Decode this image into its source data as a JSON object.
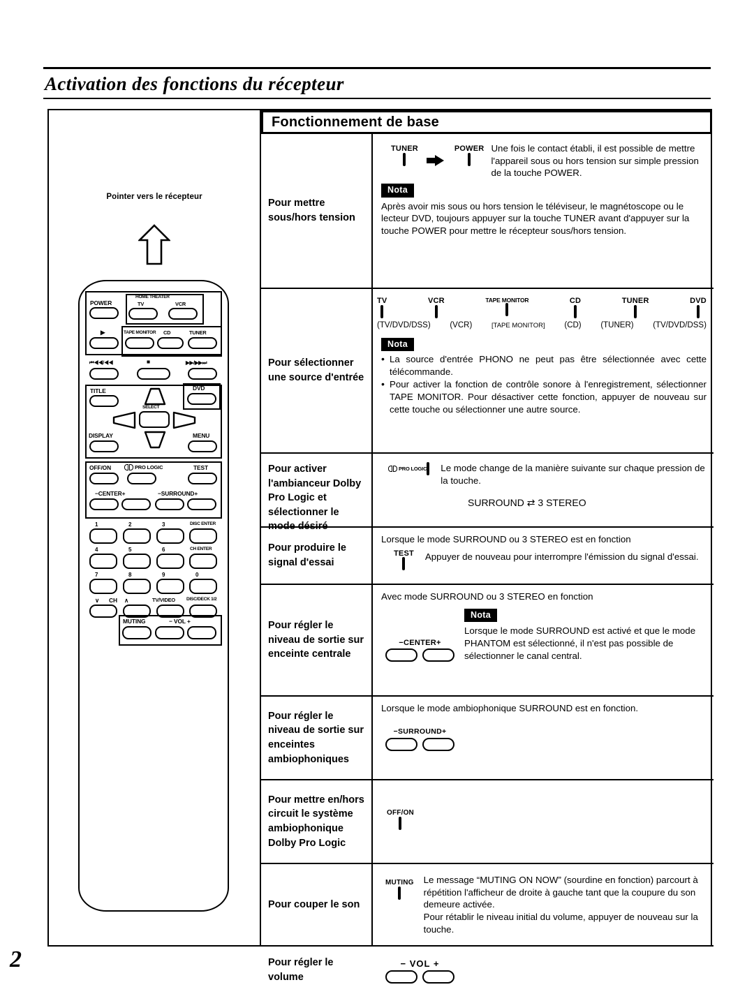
{
  "page": {
    "title": "Activation des fonctions du récepteur",
    "number": "2"
  },
  "illustration": {
    "caption": "Pointer vers le récepteur",
    "arrow_icon": "up-arrow-icon",
    "remote_labels": {
      "power": "POWER",
      "home_theater": "HOME THEATER",
      "tv": "TV",
      "vcr": "VCR",
      "play": "▶",
      "tape_monitor": "TAPE MONITOR",
      "cd": "CD",
      "tuner": "TUNER",
      "rew": "⏮◀◀/◀◀",
      "stop": "■",
      "ff": "▶▶/▶▶⏭",
      "title": "TITLE",
      "dvd": "DVD",
      "select": "SELECT",
      "display": "DISPLAY",
      "menu": "MENU",
      "off_on": "OFF/ON",
      "pro_logic": "PRO LOGIC",
      "test": "TEST",
      "center": "−CENTER+",
      "surround": "−SURROUND+",
      "keys": [
        "1",
        "2",
        "3",
        "4",
        "5",
        "6",
        "7",
        "8",
        "9",
        "0"
      ],
      "disc_enter": "DISC ENTER",
      "ch_enter": "CH ENTER",
      "ch_down": "∨",
      "ch": "CH",
      "ch_up": "∧",
      "tv_video": "TV/VIDEO",
      "disc_deck": "DISC/DECK 1/2",
      "muting": "MUTING",
      "vol": "− VOL +"
    }
  },
  "table": {
    "header": "Fonctionnement de base",
    "rows": [
      {
        "label": "Pour mettre sous/hors tension",
        "buttons": [
          {
            "cap": "TUNER"
          },
          {
            "cap": "POWER"
          }
        ],
        "arrow_between": true,
        "text": "Une fois le contact établi, il est possible de mettre l'appareil sous ou hors tension sur simple pression de la touche POWER.",
        "nota_badge": "Nota",
        "nota_text": "Après avoir mis sous ou hors tension le téléviseur, le magnétoscope ou le lecteur DVD, toujours appuyer sur la touche TUNER avant d'appuyer sur la touche POWER pour mettre le récepteur sous/hors tension."
      },
      {
        "label": "Pour sélectionner une source d'entrée",
        "source_buttons": [
          "TV",
          "VCR",
          "TAPE MONITOR",
          "CD",
          "TUNER",
          "DVD"
        ],
        "source_subcaptions": [
          "(TV/DVD/DSS)",
          "(VCR)",
          "[TAPE MONITOR]",
          "(CD)",
          "(TUNER)",
          "(TV/DVD/DSS)"
        ],
        "nota_badge": "Nota",
        "bullets": [
          "La source d'entrée PHONO ne peut pas être sélectionnée avec cette télécommande.",
          "Pour activer la fonction de contrôle sonore à l'enregistrement, sélectionner TAPE MONITOR. Pour désactiver cette fonction, appuyer de nouveau sur cette touche ou sélectionner une autre source."
        ]
      },
      {
        "label": "Pour activer l'ambianceur Dolby Pro Logic et sélectionner le mode désiré",
        "dolby_button": "PRO LOGIC",
        "text": "Le mode change de la manière suivante sur chaque pression de la touche.",
        "mode_cycle": "SURROUND ⇄ 3 STEREO"
      },
      {
        "label": "Pour produire le signal d'essai",
        "intro": "Lorsque le mode SURROUND ou 3 STEREO est en fonction",
        "button": "TEST",
        "text": "Appuyer de nouveau pour interrompre l'émission du signal d'essai."
      },
      {
        "label": "Pour régler le niveau de sortie sur enceinte centrale",
        "intro": "Avec mode SURROUND ou 3 STEREO en fonction",
        "pair_button": "−CENTER+",
        "nota_badge": "Nota",
        "nota_text": "Lorsque le mode SURROUND est activé et que le mode PHANTOM est sélectionné, il n'est pas possible de sélectionner le canal central."
      },
      {
        "label": "Pour régler le niveau de sortie sur enceintes ambiophoniques",
        "intro": "Lorsque le mode ambiophonique SURROUND est en fonction.",
        "pair_button": "−SURROUND+"
      },
      {
        "label": "Pour mettre en/hors circuit le système ambiophonique Dolby Pro Logic",
        "button": "OFF/ON"
      },
      {
        "label": "Pour couper le son",
        "button": "MUTING",
        "text": "Le message “MUTING ON NOW” (sourdine en fonction) parcourt à répétition l'afficheur de droite à gauche tant que la coupure du son demeure activée.",
        "text2": "Pour rétablir le niveau initial du volume, appuyer de nouveau sur la touche."
      },
      {
        "label": "Pour régler le volume",
        "pair_button": "− VOL +"
      }
    ]
  }
}
